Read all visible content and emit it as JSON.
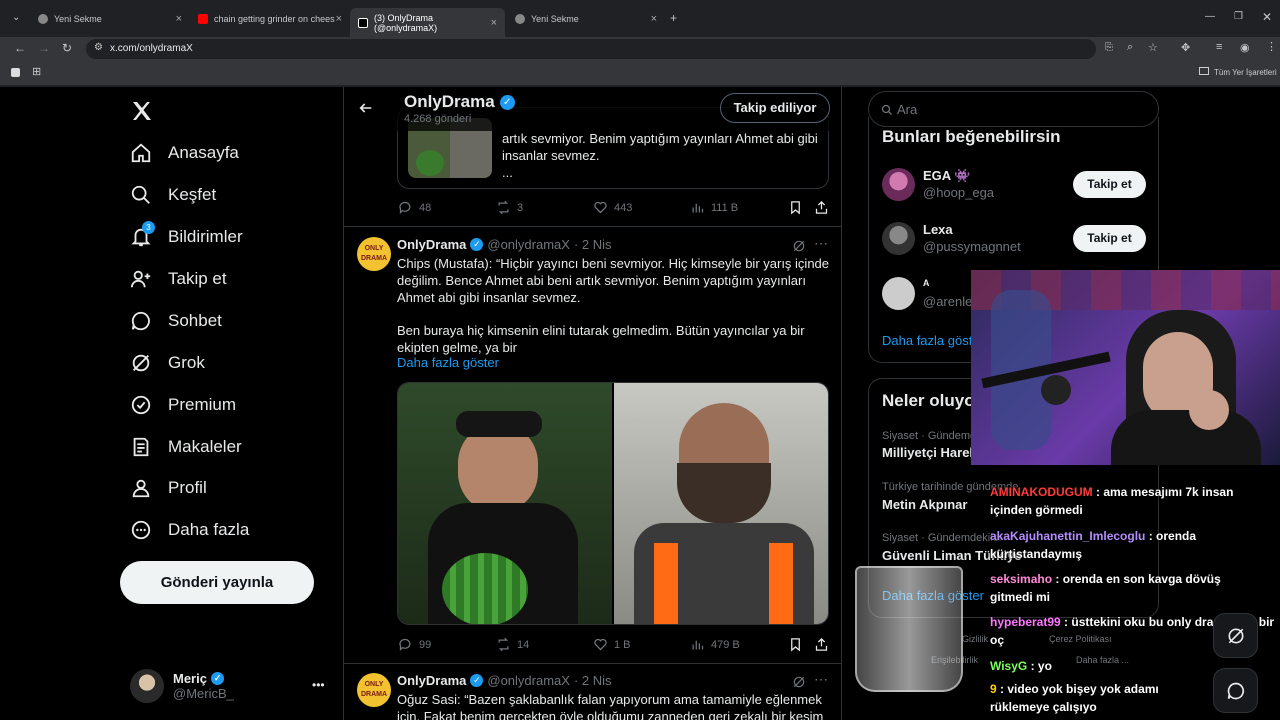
{
  "browser": {
    "tabs": [
      {
        "label": "Yeni Sekme",
        "icon": "chrome-icon"
      },
      {
        "label": "chain getting grinder on chees",
        "icon": "youtube-icon"
      },
      {
        "label": "(3) OnlyDrama (@onlydramaX)",
        "icon": "x-icon"
      },
      {
        "label": "Yeni Sekme",
        "icon": "chrome-icon"
      }
    ],
    "url": "x.com/onlydramaX",
    "bookmarks_label": "Tüm Yer İşaretleri"
  },
  "sidebar": {
    "items": [
      {
        "label": "Anasayfa",
        "icon": "home-icon"
      },
      {
        "label": "Keşfet",
        "icon": "search-icon"
      },
      {
        "label": "Bildirimler",
        "icon": "bell-icon",
        "badge": "3"
      },
      {
        "label": "Takip et",
        "icon": "follow-icon"
      },
      {
        "label": "Sohbet",
        "icon": "chat-icon"
      },
      {
        "label": "Grok",
        "icon": "grok-icon"
      },
      {
        "label": "Premium",
        "icon": "premium-icon"
      },
      {
        "label": "Makaleler",
        "icon": "articles-icon"
      },
      {
        "label": "Profil",
        "icon": "profile-icon"
      },
      {
        "label": "Daha fazla",
        "icon": "more-icon"
      }
    ],
    "post_button": "Gönderi yayınla",
    "user": {
      "name": "Meriç",
      "handle": "@MericB_",
      "more": "•••"
    }
  },
  "profile_header": {
    "name": "OnlyDrama",
    "post_count": "4.268 gönderi",
    "follow_state": "Takip ediliyor"
  },
  "tweets": [
    {
      "quoted_text": "artık sevmiyor. Benim yaptığım yayınları Ahmet abi gibi insanlar sevmez.",
      "ellipsis": "...",
      "replies": "48",
      "retweets": "3",
      "likes": "443",
      "views": "111 B"
    },
    {
      "name": "OnlyDrama",
      "handle": "@onlydramaX",
      "date": "· 2 Nis",
      "text1": "Chips (Mustafa): “Hiçbir yayıncı beni sevmiyor. Hiç kimseyle bir yarış içinde değilim. Bence Ahmet abi beni artık sevmiyor. Benim yaptığım yayınları Ahmet abi gibi insanlar sevmez.",
      "text2": "Ben buraya hiç kimsenin elini tutarak gelmedim. Bütün yayıncılar ya bir ekipten gelme, ya bir",
      "show_more": "Daha fazla göster",
      "replies": "99",
      "retweets": "14",
      "likes": "1 B",
      "views": "479 B"
    },
    {
      "name": "OnlyDrama",
      "handle": "@onlydramaX",
      "date": "· 2 Nis",
      "text1": "Oğuz Sasi: “Bazen şaklabanlık falan yapıyorum ama tamamiyle eğlenmek için. Fakat benim gerçekten öyle olduğumu zanneden geri zekalı bir kesim"
    }
  ],
  "right": {
    "search_placeholder": "Ara",
    "suggest_title": "Bunları beğenebilirsin",
    "suggestions": [
      {
        "name": "EGA",
        "handle": "@hoop_ega",
        "button": "Takip et"
      },
      {
        "name": "Lexa",
        "handle": "@pussymagnnet",
        "button": "Takip et"
      },
      {
        "name": "ᴬ",
        "handle": "@arenler"
      }
    ],
    "show_more": "Daha fazla göster",
    "trends_title": "Neler oluyor",
    "trends": [
      {
        "meta": "Siyaset · Gündemde",
        "title": "Milliyetçi Harek"
      },
      {
        "meta": "Türkiye tarihinde gündemde",
        "title": "Metin Akpınar"
      },
      {
        "meta": "Siyaset · Gündemdekiler",
        "title": "Güvenli Liman Türkiye"
      }
    ],
    "trends_more": "Daha fazla göster",
    "footer": [
      "Gizlilik",
      "Çerez Politikası",
      "Erişilebilirlik",
      "Daha fazla ..."
    ]
  },
  "stream_chat": [
    {
      "user": "AMINAKODUGUM",
      "user_color": "#ff3b3b",
      "msg": ": ama mesajımı 7k insan içinden görmedi"
    },
    {
      "user": "akaKajuhanettin_Imlecoglu",
      "user_color": "#b58cff",
      "msg": ": orenda kürtistandaymış"
    },
    {
      "user": "seksimaho",
      "user_color": "#ff8ad8",
      "msg": ": orenda en son kavga dövüş gitmedi mi"
    },
    {
      "user": "hypeberat99",
      "user_color": "#ff77ff",
      "msg": ": üsttekini oku bu only drama tam bir oç"
    },
    {
      "user": "WisyG",
      "user_color": "#7cff5c",
      "msg": ": yo"
    },
    {
      "user": "9",
      "user_color": "#ffd200",
      "msg": ": video yok bişey yok adamı rüklemeye çalışıyo"
    }
  ],
  "colors": {
    "verified": "#1d9bf0",
    "link": "#1d9bf0",
    "bg": "#000000"
  }
}
